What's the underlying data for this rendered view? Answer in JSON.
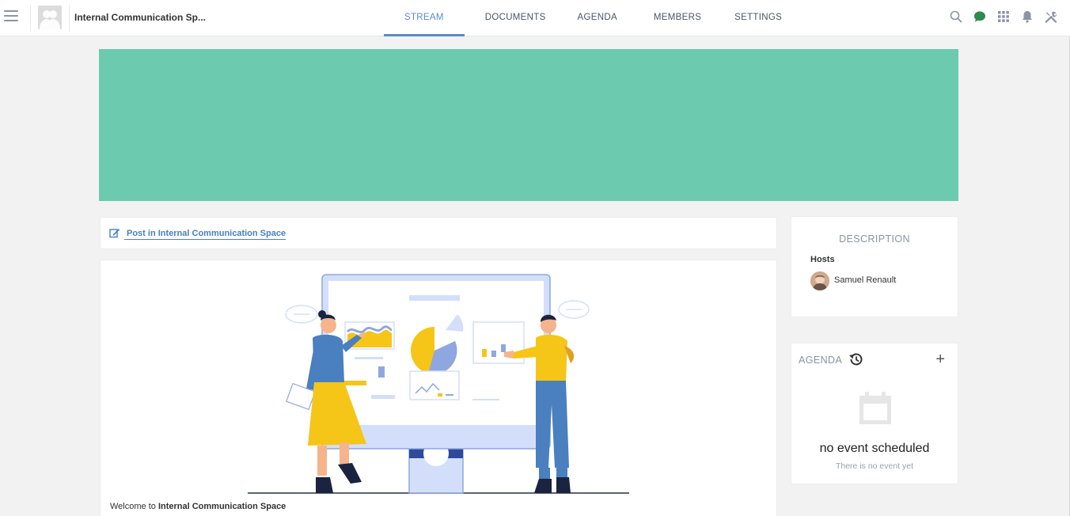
{
  "header": {
    "space_title": "Internal Communication Sp...",
    "tabs": [
      {
        "label": "STREAM",
        "active": true
      },
      {
        "label": "DOCUMENTS",
        "active": false
      },
      {
        "label": "AGENDA",
        "active": false
      },
      {
        "label": "MEMBERS",
        "active": false
      },
      {
        "label": "SETTINGS",
        "active": false
      }
    ],
    "icons": [
      "search-icon",
      "chat-icon",
      "apps-grid-icon",
      "notifications-bell-icon",
      "admin-tools-icon"
    ],
    "accent_color": "#578dc9"
  },
  "banner": {
    "color": "#6ccaae"
  },
  "composer": {
    "post_label": "Post in Internal Communication Space"
  },
  "activity": {
    "welcome_prefix": "Welcome to",
    "welcome_space": "Internal Communication Space"
  },
  "description": {
    "title": "DESCRIPTION",
    "hosts_label": "Hosts",
    "host_name": "Samuel Renault"
  },
  "agenda": {
    "title": "AGENDA",
    "empty_title": "no event scheduled",
    "empty_subtitle": "There is no event yet"
  }
}
